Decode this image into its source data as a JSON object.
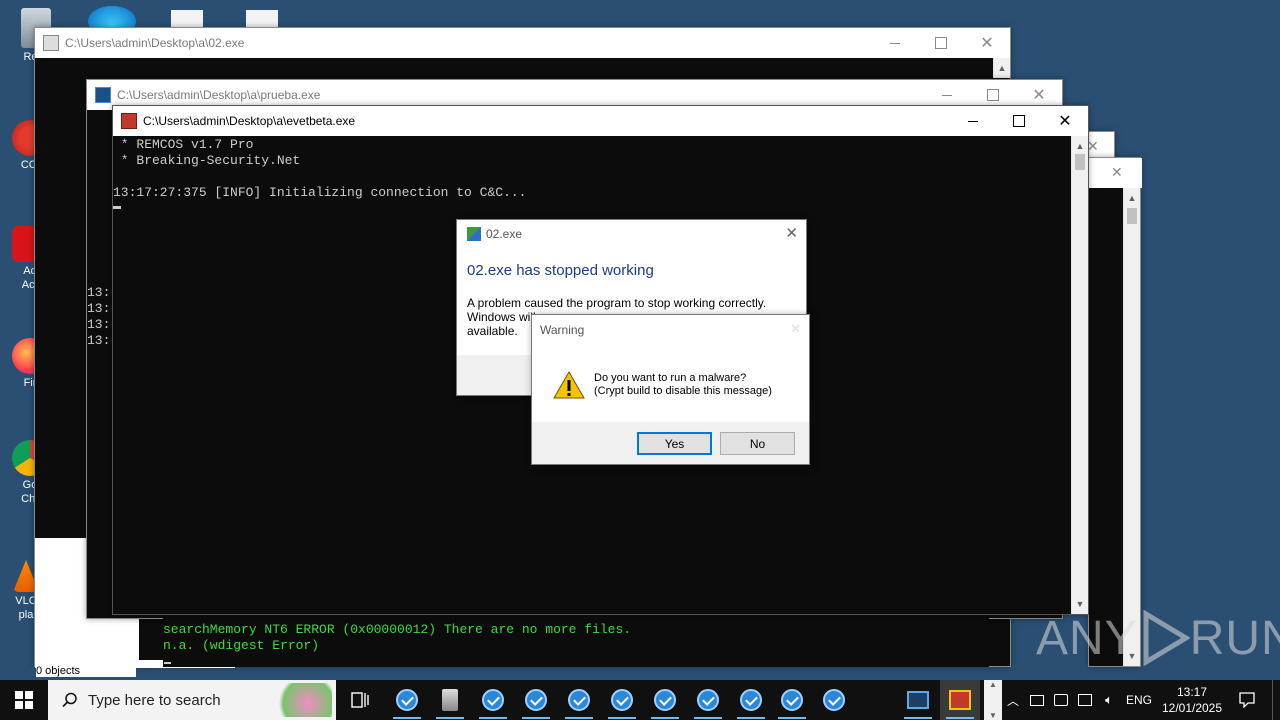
{
  "desktop": {
    "icons": [
      {
        "name": "recycle-bin",
        "label": "Recy"
      },
      {
        "name": "ccleaner",
        "label": "CCl"
      },
      {
        "name": "adobe-acrobat",
        "label": "Ad"
      },
      {
        "name": "adobe-acrobat-line2",
        "label": "Acr"
      },
      {
        "name": "firefox",
        "label": "Fir"
      },
      {
        "name": "google-chrome",
        "label": "Go"
      },
      {
        "name": "google-chrome-line2",
        "label": "Chr"
      },
      {
        "name": "vlc",
        "label": "VLC"
      },
      {
        "name": "vlc-line2",
        "label": "pla"
      }
    ]
  },
  "win02": {
    "title": "C:\\Users\\admin\\Desktop\\a\\02.exe",
    "status": "0 objects"
  },
  "winPrueba": {
    "title": "C:\\Users\\admin\\Desktop\\a\\prueba.exe"
  },
  "winEvet": {
    "title": "C:\\Users\\admin\\Desktop\\a\\evetbeta.exe",
    "lines": [
      " * REMCOS v1.7 Pro",
      " * Breaking-Security.Net",
      "",
      "13:17:27:375 [INFO] Initializing connection to C&C..."
    ]
  },
  "leftConsole": {
    "lines": [
      "13:",
      "13:",
      "13:",
      "13:"
    ]
  },
  "greenConsole": {
    "lines": [
      "searchMemory NT6 ERROR (0x00000012) There are no more files.",
      "n.a. (wdigest Error)"
    ],
    "color": "#3cdc3c"
  },
  "crashDialog": {
    "title": "02.exe",
    "heading": "02.exe has stopped working",
    "body_line1": "A problem caused the program to stop working correctly.",
    "body_line2": "Windows will",
    "body_line3": "available."
  },
  "warning": {
    "title": "Warning",
    "line1": "Do you want to run a malware?",
    "line2": "(Crypt build to disable this message)",
    "yes": "Yes",
    "no": "No"
  },
  "watermark": {
    "text_left": "ANY",
    "text_right": "RUN"
  },
  "taskbar": {
    "search_placeholder": "Type here to search",
    "language": "ENG",
    "time": "13:17",
    "date": "12/01/2025"
  },
  "colors": {
    "accent": "#0078d7",
    "heading_blue": "#1e3a8a",
    "console_bg": "#0c0c0c"
  }
}
